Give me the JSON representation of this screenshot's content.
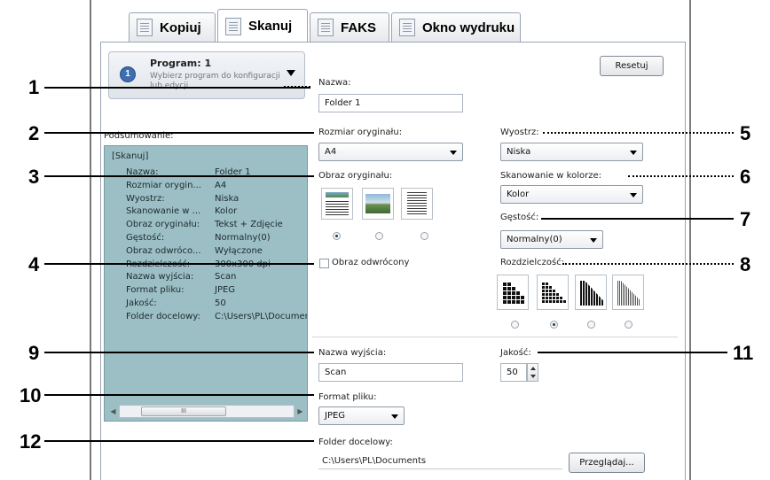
{
  "tabs": [
    {
      "label": "Kopiuj",
      "icon": "copy-icon"
    },
    {
      "label": "Skanuj",
      "icon": "scan-icon"
    },
    {
      "label": "FAKS",
      "icon": "fax-icon"
    },
    {
      "label": "Okno wydruku",
      "icon": "print-window-icon"
    }
  ],
  "program": {
    "badge": "1",
    "title": "Program: 1",
    "hint_line1": "Wybierz program do konfiguracji",
    "hint_line2": "lub edycji"
  },
  "reset_label": "Resetuj",
  "name_section": {
    "label": "Nazwa:",
    "value": "Folder 1"
  },
  "summary": {
    "label": "Podsumowanie:",
    "header": "[Skanuj]",
    "rows": [
      {
        "k": "Nazwa:",
        "v": "Folder 1"
      },
      {
        "k": "Rozmiar orygin...",
        "v": "A4"
      },
      {
        "k": "Wyostrz:",
        "v": "Niska"
      },
      {
        "k": "Skanowanie w ...",
        "v": "Kolor"
      },
      {
        "k": "Obraz oryginału:",
        "v": "Tekst + Zdjęcie"
      },
      {
        "k": "Gęstość:",
        "v": "Normalny(0)"
      },
      {
        "k": "Obraz odwróco...",
        "v": "Wyłączone"
      },
      {
        "k": "Rozdzielczość:",
        "v": "300x300 dpi"
      },
      {
        "k": "Nazwa wyjścia:",
        "v": "Scan"
      },
      {
        "k": "Format pliku:",
        "v": "JPEG"
      },
      {
        "k": "Jakość:",
        "v": "50"
      },
      {
        "k": "Folder docelowy:",
        "v": "C:\\Users\\PL\\Documen"
      }
    ],
    "scroll_thumb": "III"
  },
  "original_size": {
    "label": "Rozmiar oryginału:",
    "value": "A4"
  },
  "sharpness": {
    "label": "Wyostrz:",
    "value": "Niska"
  },
  "original_image": {
    "label": "Obraz oryginału:"
  },
  "color_scan": {
    "label": "Skanowanie w kolorze:",
    "value": "Kolor"
  },
  "density": {
    "label": "Gęstość:",
    "value": "Normalny(0)"
  },
  "inverted": {
    "label": "Obraz odwrócony"
  },
  "resolution": {
    "label": "Rozdzielczość:"
  },
  "output_name": {
    "label": "Nazwa wyjścia:",
    "value": "Scan"
  },
  "quality": {
    "label": "Jakość:",
    "value": "50"
  },
  "file_format": {
    "label": "Format pliku:",
    "value": "JPEG"
  },
  "dest_folder": {
    "label": "Folder docelowy:",
    "value": "C:\\Users\\PL\\Documents",
    "browse_label": "Przeglądaj..."
  },
  "callouts": [
    "1",
    "2",
    "3",
    "4",
    "5",
    "6",
    "7",
    "8",
    "9",
    "10",
    "11",
    "12"
  ],
  "colors": {
    "summary_bg": "#9cbfc5",
    "program_badge": "#3d6fb0"
  }
}
